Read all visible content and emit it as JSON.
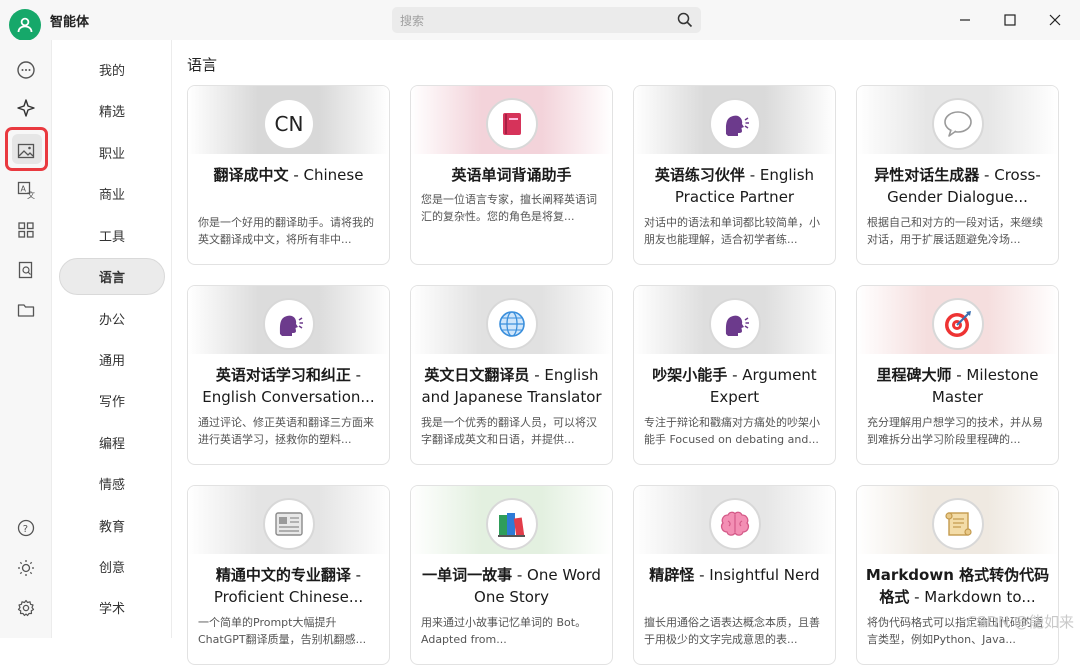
{
  "app": {
    "title": "智能体"
  },
  "search": {
    "placeholder": "搜索"
  },
  "window": {
    "minimize": "—",
    "maximize": "☐",
    "close": "✕"
  },
  "rail": {
    "icons": [
      "chat-icon",
      "agent-sparkle-icon",
      "image-icon",
      "translate-icon",
      "apps-grid-icon",
      "doc-search-icon",
      "folder-icon",
      "help-icon",
      "theme-icon",
      "settings-icon"
    ]
  },
  "categories": [
    "我的",
    "精选",
    "职业",
    "商业",
    "工具",
    "语言",
    "办公",
    "通用",
    "写作",
    "编程",
    "情感",
    "教育",
    "创意",
    "学术"
  ],
  "active_category": "语言",
  "section_title": "语言",
  "cards": [
    {
      "title_cn": "翻译成中文",
      "title_en": " - Chinese",
      "desc": "你是一个好用的翻译助手。请将我的英文翻译成中文，将所有非中...",
      "icon": "CN",
      "banner": "#d8d8d8"
    },
    {
      "title_cn": "英语单词背诵助手",
      "title_en": "",
      "desc": "您是一位语言专家，擅长阐释英语词汇的复杂性。您的角色是将复...",
      "icon": "book-icon",
      "banner": "#f3d3da"
    },
    {
      "title_cn": "英语练习伙伴",
      "title_en": " - English Practice Partner",
      "desc": "对话中的语法和单词都比较简单，小朋友也能理解，适合初学者练...",
      "icon": "speaking-head-icon",
      "banner": "#dadada"
    },
    {
      "title_cn": "异性对话生成器",
      "title_en": " - Cross-Gender Dialogue...",
      "desc": "根据自己和对方的一段对话，来继续对话，用于扩展话题避免冷场...",
      "icon": "speech-bubble-icon",
      "banner": "#e6e6e6"
    },
    {
      "title_cn": "英语对话学习和纠正",
      "title_en": " - English Conversation...",
      "desc": "通过评论、修正英语和翻译三方面来进行英语学习，拯救你的塑料...",
      "icon": "speaking-head-icon",
      "banner": "#dcdcdc"
    },
    {
      "title_cn": "英文日文翻译员",
      "title_en": " - English and Japanese Translator",
      "desc": "我是一个优秀的翻译人员，可以将汉字翻译成英文和日语，并提供...",
      "icon": "globe-icon",
      "banner": "#e1e1e1"
    },
    {
      "title_cn": "吵架小能手",
      "title_en": " - Argument Expert",
      "desc": "专注于辩论和戳痛对方痛处的吵架小能手 Focused on debating and...",
      "icon": "speaking-head-icon",
      "banner": "#dedede"
    },
    {
      "title_cn": "里程碑大师",
      "title_en": " - Milestone Master",
      "desc": "充分理解用户想学习的技术，并从易到难拆分出学习阶段里程碑的...",
      "icon": "target-icon",
      "banner": "#f5dede"
    },
    {
      "title_cn": "精通中文的专业翻译",
      "title_en": " - Proficient Chinese...",
      "desc": "一个简单的Prompt大幅提升ChatGPT翻译质量，告别机翻感...",
      "icon": "newspaper-icon",
      "banner": "#e4e4e4"
    },
    {
      "title_cn": "一单词一故事",
      "title_en": " - One Word One Story",
      "desc": "用来通过小故事记忆单词的 Bot。Adapted from...",
      "icon": "books-icon",
      "banner": "#e3f0e0"
    },
    {
      "title_cn": "精辟怪",
      "title_en": " - Insightful Nerd",
      "desc": "擅长用通俗之语表达概念本质，且善于用极少的文字完成意思的表...",
      "icon": "brain-icon",
      "banner": "#e6e6e6"
    },
    {
      "title_cn": "Markdown 格式转伪代码格式",
      "title_en": " - Markdown to...",
      "desc": "将伪代码格式可以指定输出代码的语言类型，例如Python、Java...",
      "icon": "scroll-icon",
      "banner": "#efe9e1"
    }
  ],
  "watermark": "CSDN @能如来",
  "colors": {
    "accent": "#16a86a",
    "highlight": "#e9393f",
    "purple": "#6c3a8c"
  }
}
